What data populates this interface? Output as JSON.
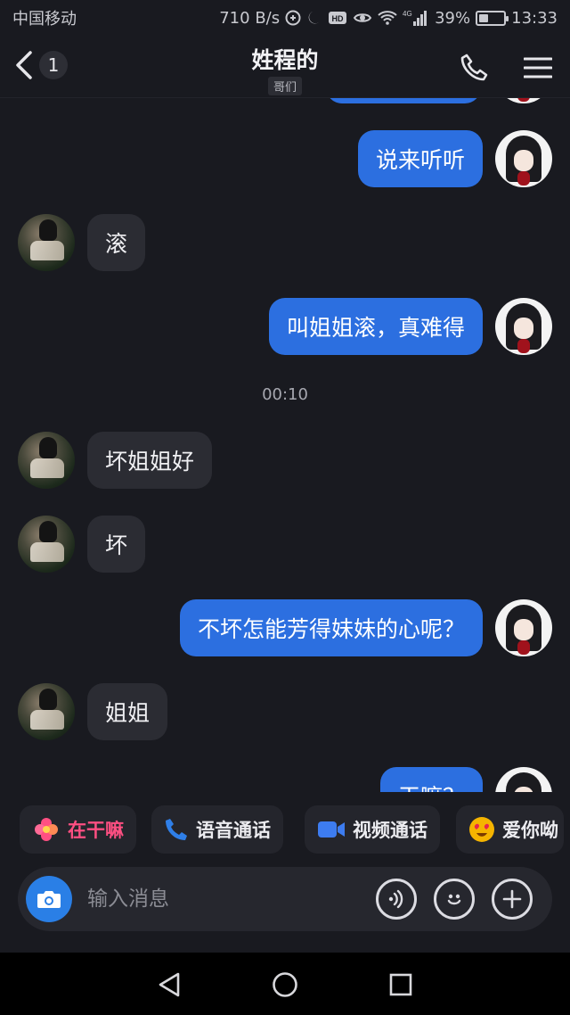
{
  "status_bar": {
    "carrier": "中国移动",
    "speed": "710 B/s",
    "network": "4G",
    "battery": "39%",
    "battery_level": 0.39,
    "time": "13:33"
  },
  "header": {
    "back_count": "1",
    "title": "姓程的",
    "subtitle": "哥们"
  },
  "messages": [
    {
      "from": "me",
      "text": "说来听听"
    },
    {
      "from": "friend",
      "text": "滚"
    },
    {
      "from": "me",
      "text": "叫姐姐滚，真难得"
    },
    {
      "timestamp": "00:10"
    },
    {
      "from": "friend",
      "text": "坏姐姐好"
    },
    {
      "from": "friend",
      "text": "坏"
    },
    {
      "from": "me",
      "text": "不坏怎能芳得妹妹的心呢？"
    },
    {
      "from": "friend",
      "text": "姐姐"
    },
    {
      "from": "me",
      "text": "干嘛？"
    }
  ],
  "quick_actions": [
    {
      "label": "在干嘛",
      "icon": "flower-icon",
      "color": "#ff4f82"
    },
    {
      "label": "语音通话",
      "icon": "phone-icon",
      "color": "#2f7fe8"
    },
    {
      "label": "视频通话",
      "icon": "video-camera-icon",
      "color": "#3d7cf0"
    },
    {
      "label": "爱你呦",
      "icon": "heart-eyes-emoji-icon",
      "color": "#f5b400"
    }
  ],
  "input": {
    "placeholder": "输入消息"
  },
  "colors": {
    "background": "#191a20",
    "outgoing_bubble": "#2c6fe0",
    "incoming_bubble": "#2b2c33",
    "accent": "#2a7fe6"
  }
}
